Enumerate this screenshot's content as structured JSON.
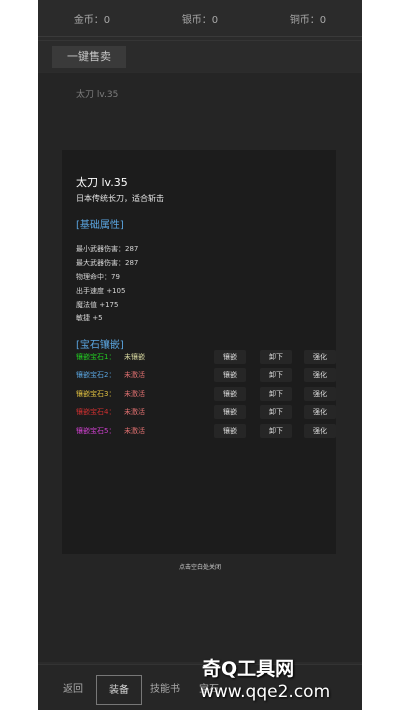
{
  "currency": {
    "gold": "金币：0",
    "silver": "银币：0",
    "copper": "铜币：0"
  },
  "toolbar": {
    "sell_all": "一键售卖"
  },
  "inventory": {
    "item": "太刀 lv.35"
  },
  "weapon": {
    "title": "太刀 lv.35",
    "desc": "日本传统长刀，适合斩击",
    "basic_header": "[基础属性]",
    "stats": [
      "最小武器伤害：287",
      "最大武器伤害：287",
      "物理命中：79",
      "出手速度 +105",
      "魔法值 +175",
      "敏捷 +5"
    ],
    "gem_header": "[宝石镶嵌]",
    "gems": [
      {
        "label": "镶嵌宝石1：",
        "status": "未镶嵌",
        "label_color": "#22cc22",
        "status_color": "#d8d8a0"
      },
      {
        "label": "镶嵌宝石2：",
        "status": "未激活",
        "label_color": "#5aa5e0",
        "status_color": "#e07070"
      },
      {
        "label": "镶嵌宝石3：",
        "status": "未激活",
        "label_color": "#e0c040",
        "status_color": "#e07070"
      },
      {
        "label": "镶嵌宝石4：",
        "status": "未激活",
        "label_color": "#d03030",
        "status_color": "#e07070"
      },
      {
        "label": "镶嵌宝石5：",
        "status": "未激活",
        "label_color": "#d040d0",
        "status_color": "#e07070"
      }
    ],
    "btn_inlay": "镶嵌",
    "btn_remove": "卸下",
    "btn_enhance": "强化",
    "close_hint": "点击空白处关闭"
  },
  "tabs": [
    "返回",
    "装备",
    "技能书",
    "宝石"
  ],
  "watermark": {
    "title": "奇Q工具网",
    "url": "www.qqe2.com"
  }
}
